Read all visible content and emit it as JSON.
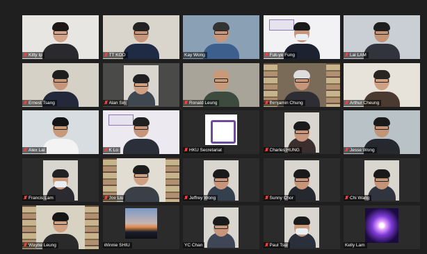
{
  "participants": [
    {
      "name": "Kitty Ip",
      "muted": true,
      "bg": "#e8e6e2",
      "skin": "#d4a48a",
      "hair": "#1c1614",
      "shirt": "#2a2a2e"
    },
    {
      "name": "TT KOO",
      "muted": true,
      "bg": "#d9d4cc",
      "skin": "#c7957a",
      "hair": "#222",
      "shirt": "#1f2a44"
    },
    {
      "name": "Kay Wong",
      "muted": false,
      "bg": "#8aa0b4",
      "skin": "#c6957a",
      "hair": "#333",
      "shirt": "#3d5f8e"
    },
    {
      "name": "Fuk-ye Fung",
      "muted": true,
      "bg": "#f2f1f4",
      "skin": "#c7957a",
      "hair": "#1a1a1a",
      "shirt": "#1c2230",
      "logo": true,
      "mask": true
    },
    {
      "name": "Lai LAM",
      "muted": true,
      "bg": "#c9cfd4",
      "skin": "#c49476",
      "hair": "#1e1e1e",
      "shirt": "#31343c"
    },
    {
      "name": "Ernest Tsang",
      "muted": true,
      "bg": "#d5d1c6",
      "skin": "#c7957a",
      "hair": "#1d1d1d",
      "shirt": "#23283a"
    },
    {
      "name": "Alan Sin",
      "muted": true,
      "bg": "#4a4a48",
      "skin": "#d0a082",
      "hair": "#202020",
      "shirt": "#3f4750",
      "inset": true
    },
    {
      "name": "Ronald Leung",
      "muted": true,
      "bg": "#a8a49a",
      "skin": "#c99a7a",
      "hair": "#c99a7a",
      "shirt": "#3d4a3e",
      "active": true
    },
    {
      "name": "Benjamin Chung",
      "muted": true,
      "bg": "#7a6a58",
      "skin": "#c7957a",
      "hair": "#ddd",
      "shirt": "#2d2d33",
      "shelf": true
    },
    {
      "name": "Arthur Cheung",
      "muted": true,
      "bg": "#e7e2da",
      "skin": "#d0a082",
      "hair": "#2a2420",
      "shirt": "#4a3a30"
    },
    {
      "name": "Alex Lai",
      "muted": true,
      "bg": "#d8dde2",
      "skin": "#c99a7a",
      "hair": "#141414",
      "shirt": "#f3f3f3"
    },
    {
      "name": "K Lo",
      "muted": true,
      "bg": "#eceaf0",
      "skin": "#c7957a",
      "hair": "#202020",
      "shirt": "#2b2f3a",
      "logo": true
    },
    {
      "name": "HKU Secretariat",
      "muted": true,
      "bg": "#2a2a2a",
      "purpleLogo": true
    },
    {
      "name": "Charles HUNG",
      "muted": true,
      "bg": "#2b2b2b",
      "skin": "#c7957a",
      "hair": "#1a1a1a",
      "shirt": "#3a2e2e",
      "inset": true
    },
    {
      "name": "Jesse Wong",
      "muted": true,
      "bg": "#b9c2c6",
      "skin": "#c49476",
      "hair": "#1a1a1a",
      "shirt": "#25282e"
    },
    {
      "name": "Francis Lam",
      "muted": true,
      "bg": "#2b2b2b",
      "skin": "#c99a7a",
      "hair": "#222",
      "shirt": "#2a2a30",
      "inset": true,
      "mask": true
    },
    {
      "name": "Joe Liu",
      "muted": true,
      "bg": "#e1ddd2",
      "skin": "#cfa084",
      "hair": "#1c1c1c",
      "shirt": "#3a3f48",
      "shelf": true
    },
    {
      "name": "Jeffrey Wong",
      "muted": true,
      "bg": "#2b2b2b",
      "skin": "#c7957a",
      "hair": "#1a1a1a",
      "shirt": "#34404e",
      "inset": true
    },
    {
      "name": "Sunny Chor",
      "muted": true,
      "bg": "#2b2b2b",
      "skin": "#c7957a",
      "hair": "#1a1a1a",
      "shirt": "#25282e",
      "inset": true
    },
    {
      "name": "Chi Wang",
      "muted": true,
      "bg": "#2b2b2b",
      "skin": "#c49476",
      "hair": "#1a1a1a",
      "shirt": "#30343e",
      "inset": true
    },
    {
      "name": "Wayne Leung",
      "muted": true,
      "bg": "#d8d2c2",
      "skin": "#d0a082",
      "hair": "#161616",
      "shirt": "#2a2a2a",
      "shelf": true
    },
    {
      "name": "Winnie SHIU",
      "muted": false,
      "bg": "#2b2b2b",
      "sunset": true
    },
    {
      "name": "YC Chan",
      "muted": false,
      "bg": "#2b2b2b",
      "skin": "#c7957a",
      "hair": "#1a1a1a",
      "shirt": "#3f4656",
      "inset": true
    },
    {
      "name": "Paul Tsui",
      "muted": true,
      "bg": "#2b2b2b",
      "skin": "#c99a7a",
      "hair": "#1a1a1a",
      "shirt": "#2a2f3c",
      "inset": true,
      "mask": true
    },
    {
      "name": "Kelly Lam",
      "muted": false,
      "bg": "#2b2b2b",
      "galaxy": true
    }
  ],
  "colors": {
    "active_border": "#d6cf3a",
    "muted_mic": "#ff3b3b",
    "background": "#1f1f1f"
  },
  "icons": {
    "muted": "microphone-muted-icon"
  }
}
